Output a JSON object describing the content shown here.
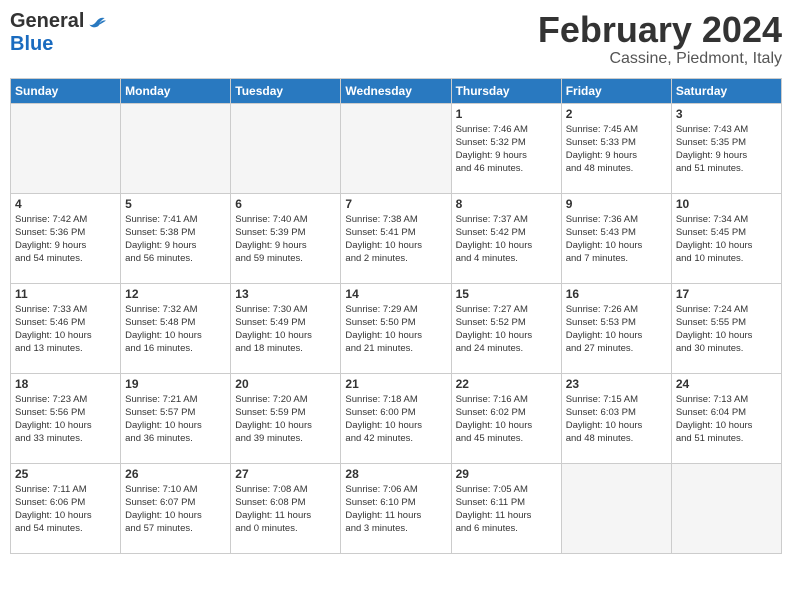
{
  "header": {
    "logo_general": "General",
    "logo_blue": "Blue",
    "month_title": "February 2024",
    "location": "Cassine, Piedmont, Italy"
  },
  "weekdays": [
    "Sunday",
    "Monday",
    "Tuesday",
    "Wednesday",
    "Thursday",
    "Friday",
    "Saturday"
  ],
  "weeks": [
    [
      {
        "day": "",
        "detail": ""
      },
      {
        "day": "",
        "detail": ""
      },
      {
        "day": "",
        "detail": ""
      },
      {
        "day": "",
        "detail": ""
      },
      {
        "day": "1",
        "detail": "Sunrise: 7:46 AM\nSunset: 5:32 PM\nDaylight: 9 hours\nand 46 minutes."
      },
      {
        "day": "2",
        "detail": "Sunrise: 7:45 AM\nSunset: 5:33 PM\nDaylight: 9 hours\nand 48 minutes."
      },
      {
        "day": "3",
        "detail": "Sunrise: 7:43 AM\nSunset: 5:35 PM\nDaylight: 9 hours\nand 51 minutes."
      }
    ],
    [
      {
        "day": "4",
        "detail": "Sunrise: 7:42 AM\nSunset: 5:36 PM\nDaylight: 9 hours\nand 54 minutes."
      },
      {
        "day": "5",
        "detail": "Sunrise: 7:41 AM\nSunset: 5:38 PM\nDaylight: 9 hours\nand 56 minutes."
      },
      {
        "day": "6",
        "detail": "Sunrise: 7:40 AM\nSunset: 5:39 PM\nDaylight: 9 hours\nand 59 minutes."
      },
      {
        "day": "7",
        "detail": "Sunrise: 7:38 AM\nSunset: 5:41 PM\nDaylight: 10 hours\nand 2 minutes."
      },
      {
        "day": "8",
        "detail": "Sunrise: 7:37 AM\nSunset: 5:42 PM\nDaylight: 10 hours\nand 4 minutes."
      },
      {
        "day": "9",
        "detail": "Sunrise: 7:36 AM\nSunset: 5:43 PM\nDaylight: 10 hours\nand 7 minutes."
      },
      {
        "day": "10",
        "detail": "Sunrise: 7:34 AM\nSunset: 5:45 PM\nDaylight: 10 hours\nand 10 minutes."
      }
    ],
    [
      {
        "day": "11",
        "detail": "Sunrise: 7:33 AM\nSunset: 5:46 PM\nDaylight: 10 hours\nand 13 minutes."
      },
      {
        "day": "12",
        "detail": "Sunrise: 7:32 AM\nSunset: 5:48 PM\nDaylight: 10 hours\nand 16 minutes."
      },
      {
        "day": "13",
        "detail": "Sunrise: 7:30 AM\nSunset: 5:49 PM\nDaylight: 10 hours\nand 18 minutes."
      },
      {
        "day": "14",
        "detail": "Sunrise: 7:29 AM\nSunset: 5:50 PM\nDaylight: 10 hours\nand 21 minutes."
      },
      {
        "day": "15",
        "detail": "Sunrise: 7:27 AM\nSunset: 5:52 PM\nDaylight: 10 hours\nand 24 minutes."
      },
      {
        "day": "16",
        "detail": "Sunrise: 7:26 AM\nSunset: 5:53 PM\nDaylight: 10 hours\nand 27 minutes."
      },
      {
        "day": "17",
        "detail": "Sunrise: 7:24 AM\nSunset: 5:55 PM\nDaylight: 10 hours\nand 30 minutes."
      }
    ],
    [
      {
        "day": "18",
        "detail": "Sunrise: 7:23 AM\nSunset: 5:56 PM\nDaylight: 10 hours\nand 33 minutes."
      },
      {
        "day": "19",
        "detail": "Sunrise: 7:21 AM\nSunset: 5:57 PM\nDaylight: 10 hours\nand 36 minutes."
      },
      {
        "day": "20",
        "detail": "Sunrise: 7:20 AM\nSunset: 5:59 PM\nDaylight: 10 hours\nand 39 minutes."
      },
      {
        "day": "21",
        "detail": "Sunrise: 7:18 AM\nSunset: 6:00 PM\nDaylight: 10 hours\nand 42 minutes."
      },
      {
        "day": "22",
        "detail": "Sunrise: 7:16 AM\nSunset: 6:02 PM\nDaylight: 10 hours\nand 45 minutes."
      },
      {
        "day": "23",
        "detail": "Sunrise: 7:15 AM\nSunset: 6:03 PM\nDaylight: 10 hours\nand 48 minutes."
      },
      {
        "day": "24",
        "detail": "Sunrise: 7:13 AM\nSunset: 6:04 PM\nDaylight: 10 hours\nand 51 minutes."
      }
    ],
    [
      {
        "day": "25",
        "detail": "Sunrise: 7:11 AM\nSunset: 6:06 PM\nDaylight: 10 hours\nand 54 minutes."
      },
      {
        "day": "26",
        "detail": "Sunrise: 7:10 AM\nSunset: 6:07 PM\nDaylight: 10 hours\nand 57 minutes."
      },
      {
        "day": "27",
        "detail": "Sunrise: 7:08 AM\nSunset: 6:08 PM\nDaylight: 11 hours\nand 0 minutes."
      },
      {
        "day": "28",
        "detail": "Sunrise: 7:06 AM\nSunset: 6:10 PM\nDaylight: 11 hours\nand 3 minutes."
      },
      {
        "day": "29",
        "detail": "Sunrise: 7:05 AM\nSunset: 6:11 PM\nDaylight: 11 hours\nand 6 minutes."
      },
      {
        "day": "",
        "detail": ""
      },
      {
        "day": "",
        "detail": ""
      }
    ]
  ]
}
